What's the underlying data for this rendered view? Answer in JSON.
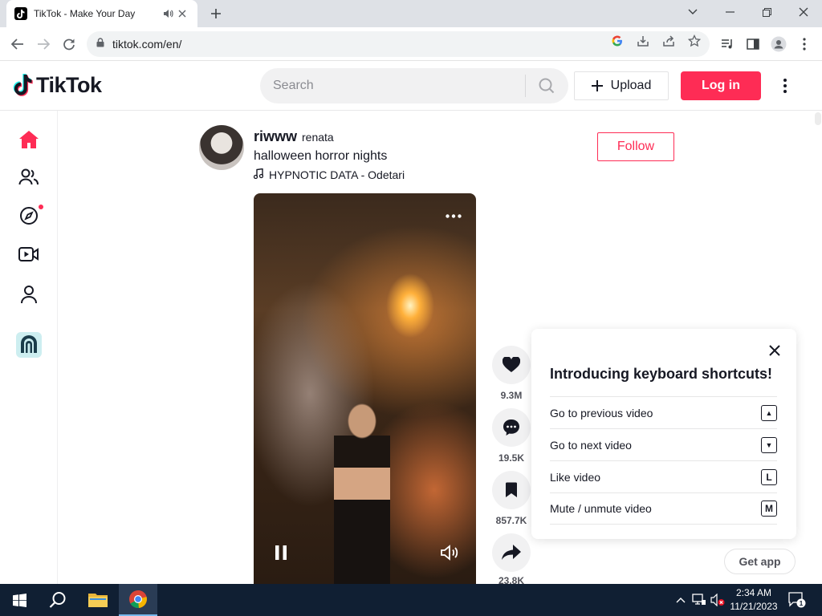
{
  "browser": {
    "tab_title": "TikTok - Make Your Day",
    "url": "tiktok.com/en/"
  },
  "header": {
    "logo_text": "TikTok",
    "search_placeholder": "Search",
    "upload_label": "Upload",
    "login_label": "Log in"
  },
  "post": {
    "username": "riwww",
    "nickname": "renata",
    "caption": "halloween horror nights",
    "music": "HYPNOTIC DATA - Odetari",
    "follow_label": "Follow",
    "likes": "9.3M",
    "comments": "19.5K",
    "saves": "857.7K",
    "shares": "23.8K"
  },
  "shortcuts": {
    "title": "Introducing keyboard shortcuts!",
    "items": [
      {
        "label": "Go to previous video",
        "key": "▲"
      },
      {
        "label": "Go to next video",
        "key": "▼"
      },
      {
        "label": "Like video",
        "key": "L"
      },
      {
        "label": "Mute / unmute video",
        "key": "M"
      }
    ]
  },
  "getapp_label": "Get app",
  "taskbar": {
    "time": "2:34 AM",
    "date": "11/21/2023",
    "notification_count": "1"
  },
  "colors": {
    "brand": "#fe2c55",
    "taskbar": "#101f33"
  }
}
